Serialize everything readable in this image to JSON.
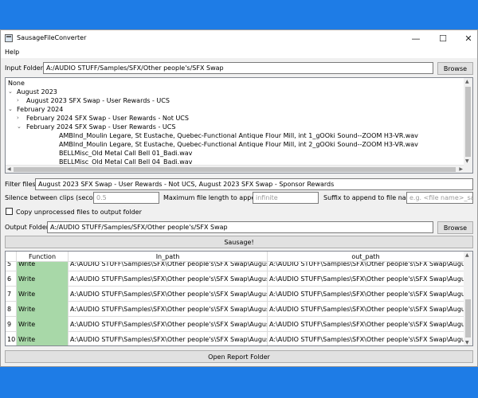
{
  "window": {
    "title": "SausageFileConverter",
    "controls": {
      "minimize": "—",
      "maximize": "☐",
      "close": "✕"
    }
  },
  "menu": {
    "help": "Help"
  },
  "input_folder": {
    "label": "Input Folder:",
    "value": "A:/AUDIO STUFF/Samples/SFX/Other people's/SFX Swap",
    "browse": "Browse"
  },
  "tree": {
    "items": [
      {
        "text": "None",
        "chevron": "",
        "indent": 0
      },
      {
        "text": "August 2023",
        "chevron": "⌄",
        "indent": 0
      },
      {
        "text": "August 2023 SFX Swap - User Rewards - UCS",
        "chevron": "›",
        "indent": 1
      },
      {
        "text": "February 2024",
        "chevron": "⌄",
        "indent": 0
      },
      {
        "text": "February 2024 SFX Swap - User Rewards - Not UCS",
        "chevron": "›",
        "indent": 1
      },
      {
        "text": "February 2024 SFX Swap - User Rewards - UCS",
        "chevron": "⌄",
        "indent": 1
      },
      {
        "text": "AMBInd_Moulin Legare, St Eustache, Quebec-Functional Antique Flour Mill, int 1_gOOki Sound--ZOOM H3-VR.wav",
        "chevron": "",
        "indent": 2
      },
      {
        "text": "AMBInd_Moulin Legare, St Eustache, Quebec-Functional Antique Flour Mill, int 2_gOOki Sound--ZOOM H3-VR.wav",
        "chevron": "",
        "indent": 2
      },
      {
        "text": "BELLMisc_Old Metal Call Bell 01_Badi.wav",
        "chevron": "",
        "indent": 2
      },
      {
        "text": "BELLMisc_Old Metal Call Bell 04_Badi.wav",
        "chevron": "",
        "indent": 2
      }
    ]
  },
  "filter": {
    "label": "Filter files:",
    "value": "August 2023 SFX Swap - User Rewards - Not UCS, August 2023 SFX Swap - Sponsor Rewards"
  },
  "silence": {
    "label": "Silence between clips (seconds)",
    "value": "0.5"
  },
  "max_length": {
    "label": "Maximum file length to append",
    "value": "infinite"
  },
  "suffix": {
    "label": "Suffix to append to file name:",
    "placeholder": "e.g. <file name>_saus..."
  },
  "copy_unprocessed": {
    "label": "Copy unprocessed files to output folder",
    "checked": false
  },
  "output_folder": {
    "label": "Output Folder:",
    "value": "A:/AUDIO STUFF/Samples/SFX/Other people's/SFX Swap",
    "browse": "Browse"
  },
  "sausage_button": "Sausage!",
  "table": {
    "headers": {
      "function": "Function",
      "in_path": "In_path",
      "out_path": "out_path"
    },
    "rows": [
      {
        "num": "5",
        "function": "Write",
        "in_path": "A:\\AUDIO STUFF\\Samples\\SFX\\Other people's\\SFX Swap\\August ...",
        "out_path": "A:\\AUDIO STUFF\\Samples\\SFX\\Other people's\\SFX Swap\\Augu..."
      },
      {
        "num": "6",
        "function": "Write",
        "in_path": "A:\\AUDIO STUFF\\Samples\\SFX\\Other people's\\SFX Swap\\August ...",
        "out_path": "A:\\AUDIO STUFF\\Samples\\SFX\\Other people's\\SFX Swap\\Augu..."
      },
      {
        "num": "7",
        "function": "Write",
        "in_path": "A:\\AUDIO STUFF\\Samples\\SFX\\Other people's\\SFX Swap\\August ...",
        "out_path": "A:\\AUDIO STUFF\\Samples\\SFX\\Other people's\\SFX Swap\\Augu..."
      },
      {
        "num": "8",
        "function": "Write",
        "in_path": "A:\\AUDIO STUFF\\Samples\\SFX\\Other people's\\SFX Swap\\August ...",
        "out_path": "A:\\AUDIO STUFF\\Samples\\SFX\\Other people's\\SFX Swap\\Augu..."
      },
      {
        "num": "9",
        "function": "Write",
        "in_path": "A:\\AUDIO STUFF\\Samples\\SFX\\Other people's\\SFX Swap\\August ...",
        "out_path": "A:\\AUDIO STUFF\\Samples\\SFX\\Other people's\\SFX Swap\\Augu..."
      },
      {
        "num": "10",
        "function": "Write",
        "in_path": "A:\\AUDIO STUFF\\Samples\\SFX\\Other people's\\SFX Swap\\August ...",
        "out_path": "A:\\AUDIO STUFF\\Samples\\SFX\\Other people's\\SFX Swap\\Augu..."
      }
    ]
  },
  "open_report": "Open Report Folder",
  "colors": {
    "desktop": "#1e7ce6",
    "function_cell": "#a8d8a8"
  }
}
